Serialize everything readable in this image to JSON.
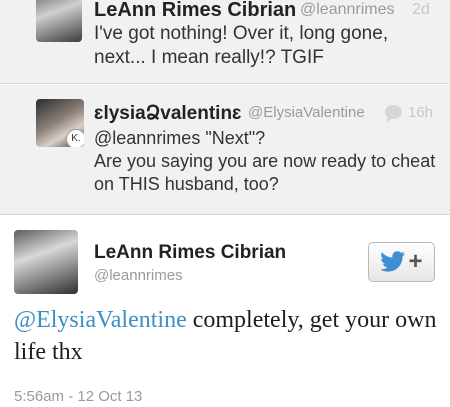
{
  "tweets": {
    "top": {
      "name": "LeAnn Rimes Cibrian",
      "handle": "@leannrimes",
      "time": "2d",
      "text": "I've got nothing! Over it, long gone, next... I mean really!? TGIF"
    },
    "reply": {
      "name": "ɛlysiaՁvalentinɛ",
      "handle": "@ElysiaValentine",
      "time": "16h",
      "avatar_badge": "K.",
      "text_line1": "@leannrimes \"Next\"?",
      "text_line2": "Are you saying you are now ready to cheat on THIS husband, too?"
    },
    "main": {
      "name": "LeAnn Rimes Cibrian",
      "handle": "@leannrimes",
      "mention": "@ElysiaValentine",
      "text": " completely, get your own life thx",
      "timestamp": "5:56am - 12 Oct 13",
      "follow_plus": "+"
    }
  },
  "colors": {
    "mention": "#3a8fc4",
    "twitter_bird": "#3d8fd1",
    "muted_background": "#f1f1f1"
  },
  "icons": {
    "follow": "twitter-bird-icon",
    "reply_count": "speech-bubble-icon"
  }
}
